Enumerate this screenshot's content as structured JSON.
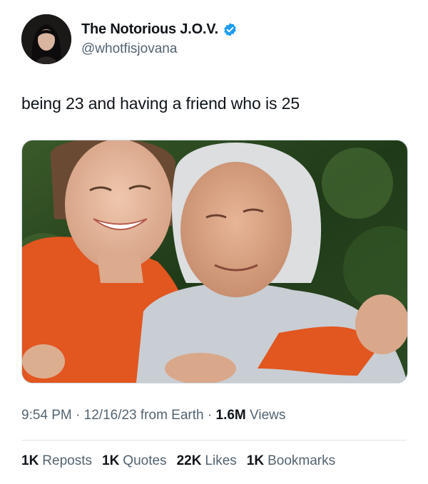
{
  "author": {
    "display_name": "The Notorious J.O.V.",
    "handle": "@whotfisjovana",
    "avatar_icon": "profile-photo",
    "verified_icon": "verified-badge-icon",
    "verified_color": "#1d9bf0"
  },
  "tweet": {
    "text": "being 23 and having a friend who is 25"
  },
  "meta": {
    "time": "9:54 PM",
    "sep1": " · ",
    "date": "12/16/23",
    "source": " from Earth",
    "sep2": " · ",
    "views_count": "1.6M",
    "views_label": " Views"
  },
  "stats": {
    "reposts_count": "1K",
    "reposts_label": "Reposts",
    "quotes_count": "1K",
    "quotes_label": "Quotes",
    "likes_count": "22K",
    "likes_label": "Likes",
    "bookmarks_count": "1K",
    "bookmarks_label": "Bookmarks"
  }
}
